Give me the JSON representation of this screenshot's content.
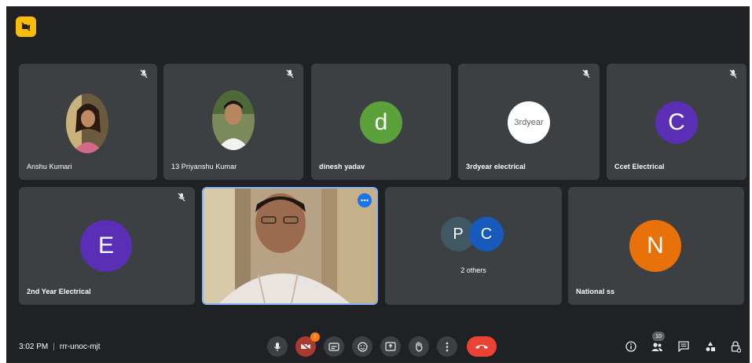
{
  "colors": {
    "background": "#202124",
    "tile": "#3c4043",
    "end_call": "#ea4335",
    "accent_blue": "#1a73e8"
  },
  "participants_row1": [
    {
      "name": "Anshu Kumari",
      "avatar_type": "photo",
      "muted": true
    },
    {
      "name": "13 Priyanshu Kumar",
      "avatar_type": "photo",
      "muted": true
    },
    {
      "name": "dinesh yadav",
      "avatar_type": "letter",
      "letter": "d",
      "color": "#5aa13a",
      "muted": false
    },
    {
      "name": "3rdyear electrical",
      "avatar_type": "text",
      "letter": "3rdyear",
      "color": "#ffffff",
      "muted": true
    },
    {
      "name": "Ccet Electrical",
      "avatar_type": "letter",
      "letter": "C",
      "color": "#5b2fb5",
      "muted": true
    }
  ],
  "participants_row2": [
    {
      "name": "2nd Year Electrical",
      "avatar_type": "letter",
      "letter": "E",
      "color": "#5b2fb5",
      "muted": true
    },
    {
      "name": "",
      "avatar_type": "video",
      "active_speaker": true
    },
    {
      "name": "2 others",
      "avatar_type": "group",
      "letters": [
        "P",
        "C"
      ],
      "colors": [
        "#3f5863",
        "#185abc"
      ]
    },
    {
      "name": "National ss",
      "avatar_type": "letter",
      "letter": "N",
      "color": "#e8710a",
      "muted": false
    }
  ],
  "bottom_bar": {
    "time": "3:02 PM",
    "meeting_code": "rrr-unoc-mjt",
    "controls": [
      "mic-icon",
      "camera-off-icon",
      "captions-icon",
      "emoji-icon",
      "present-icon",
      "raise-hand-icon",
      "more-options-icon",
      "end-call-icon"
    ],
    "camera_badge": "!",
    "people_count": "10",
    "right_icons": [
      "info-icon",
      "people-icon",
      "chat-icon",
      "activities-icon",
      "host-controls-icon"
    ]
  }
}
